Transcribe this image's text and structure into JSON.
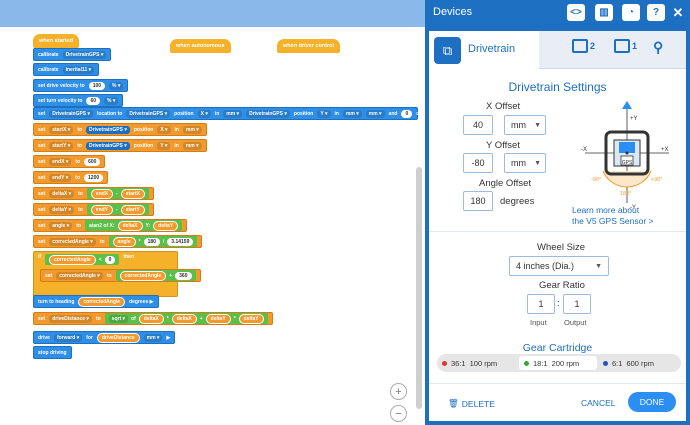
{
  "canvas": {
    "hats": {
      "when_started": "when started",
      "when_autonomous": "when autonomous",
      "when_driver_control": "when driver control"
    },
    "blocks": {
      "calibrate_gps": [
        "calibrate",
        "DrivetrainGPS ▾"
      ],
      "calibrate_inertial": [
        "calibrate",
        "Inertial11 ▾"
      ],
      "set_drive_velocity": [
        "set drive velocity to",
        "100",
        "% ▾"
      ],
      "set_turn_velocity": [
        "set turn velocity to",
        "60",
        "% ▾"
      ],
      "set_drivetrain_location": [
        "set",
        "DrivetrainGPS ▾",
        "location to",
        "DrivetrainGPS ▾",
        "position",
        "X ▾",
        "in",
        "mm ▾",
        "DrivetrainGPS ▾",
        "position",
        "Y ▾",
        "in",
        "mm ▾",
        "mm ▾",
        "and",
        "0",
        "degrees"
      ],
      "set_startX": [
        "set",
        "startX ▾",
        "to",
        "DrivetrainGPS ▾",
        "position",
        "X ▾",
        "in",
        "mm ▾"
      ],
      "set_startY": [
        "set",
        "startY ▾",
        "to",
        "DrivetrainGPS ▾",
        "position",
        "Y ▾",
        "in",
        "mm ▾"
      ],
      "set_endX": [
        "set",
        "endX ▾",
        "to",
        "600"
      ],
      "set_endY": [
        "set",
        "endY ▾",
        "to",
        "1200"
      ],
      "set_deltaX": [
        "set",
        "deltaX ▾",
        "to",
        "endX",
        "-",
        "startX"
      ],
      "set_deltaY": [
        "set",
        "deltaY ▾",
        "to",
        "endY",
        "-",
        "startY"
      ],
      "set_angle": [
        "set",
        "angle ▾",
        "to",
        "atan2 of X:",
        "deltaX",
        "Y:",
        "deltaY"
      ],
      "set_corrected_angle": [
        "set",
        "correctedAngle ▾",
        "to",
        "angle",
        "*",
        "180",
        "/",
        "3.14159"
      ],
      "if_block": [
        "if",
        "correctedAngle",
        "<",
        "0",
        "then"
      ],
      "set_corrected_angle_2": [
        "set",
        "correctedAngle ▾",
        "to",
        "correctedAngle",
        "+",
        "360"
      ],
      "turn_to_heading": [
        "turn to heading",
        "correctedAngle",
        "degrees ▶"
      ],
      "set_drive_distance": [
        "set",
        "driveDistance ▾",
        "to",
        "sqrt ▾",
        "of",
        "deltaX",
        "*",
        "deltaX",
        "+",
        "deltaY",
        "*",
        "deltaY"
      ],
      "drive_forward": [
        "drive",
        "forward ▾",
        "for",
        "driveDistance",
        "mm ▾",
        "▶"
      ],
      "stop_driving": [
        "stop driving"
      ]
    },
    "zoom_in": "+",
    "zoom_out": "−"
  },
  "devices_panel": {
    "title": "Devices",
    "header_icons": [
      "code-icon",
      "brain-icon",
      "dashboard-icon",
      "help-icon",
      "close-icon"
    ],
    "tab": {
      "label": "Drivetrain",
      "counts": [
        "2",
        "1"
      ]
    },
    "settings_title": "Drivetrain Settings",
    "x_offset": {
      "label": "X Offset",
      "value": "40",
      "unit": "mm"
    },
    "y_offset": {
      "label": "Y Offset",
      "value": "-80",
      "unit": "mm"
    },
    "angle_offset": {
      "label": "Angle Offset",
      "value": "180",
      "unit": "degrees"
    },
    "diagram": {
      "top": "+Y",
      "bottom": "-Y",
      "left": "-X",
      "right": "+X",
      "deg_left": "-90°",
      "deg_right": "+90°",
      "deg_bottom": "180°",
      "gps": "GPS"
    },
    "learn_more": [
      "Learn more about",
      "the V5 GPS Sensor >"
    ],
    "wheel_size": {
      "label": "Wheel Size",
      "value": "4 inches (Dia.)"
    },
    "gear_ratio": {
      "label": "Gear Ratio",
      "input": "1",
      "output": "1",
      "sep": ":",
      "input_label": "Input",
      "output_label": "Output"
    },
    "gear_cartridge": {
      "title": "Gear Cartridge",
      "options": [
        {
          "ratio": "36:1",
          "rpm": "100 rpm",
          "color": "#e0392b"
        },
        {
          "ratio": "18:1",
          "rpm": "200 rpm",
          "color": "#3aa63a"
        },
        {
          "ratio": "6:1",
          "rpm": "600 rpm",
          "color": "#2458b8"
        }
      ],
      "selected": "18:1"
    },
    "footer": {
      "delete": "DELETE",
      "cancel": "CANCEL",
      "done": "DONE"
    }
  }
}
